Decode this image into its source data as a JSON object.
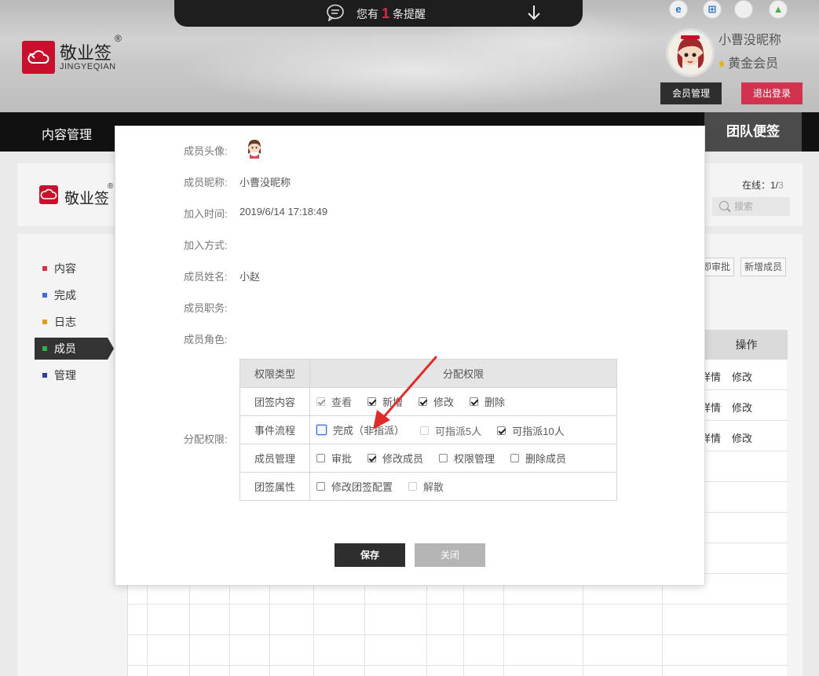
{
  "notice": {
    "prefix": "您有",
    "count": "1",
    "suffix": "条提醒"
  },
  "brand": {
    "name": "敬业签",
    "reg": "®",
    "pinyin": "JINGYEQIAN"
  },
  "os_icons": [
    "ie-icon",
    "windows-icon",
    "apple-icon",
    "android-icon"
  ],
  "user": {
    "name": "小曹没昵称",
    "level": "黄金会员",
    "member_btn": "会员管理",
    "logout_btn": "退出登录"
  },
  "nav": {
    "content_mgmt": "内容管理",
    "team": "团队便签"
  },
  "panel": {
    "online_label": "在线：1/",
    "online_total": "3",
    "search_placeholder": "搜索"
  },
  "sidebar": [
    {
      "label": "内容",
      "color": "#d2324e"
    },
    {
      "label": "完成",
      "color": "#3b6fd6"
    },
    {
      "label": "日志",
      "color": "#e69a1c"
    },
    {
      "label": "成员",
      "color": "#2bb24c"
    },
    {
      "label": "管理",
      "color": "#2c3e9e"
    }
  ],
  "bg_buttons": {
    "approve": "即审批",
    "add_member": "新增成员"
  },
  "bg_table": {
    "ops_header": "操作",
    "rows": [
      {
        "detail": "详情",
        "edit": "修改"
      },
      {
        "detail": "详情",
        "edit": "修改"
      },
      {
        "detail": "详情",
        "edit": "修改"
      }
    ]
  },
  "modal": {
    "fields": {
      "avatar_label": "成员头像:",
      "nickname_label": "成员昵称:",
      "nickname": "小曹没昵称",
      "join_time_label": "加入时间:",
      "join_time": "2019/6/14 17:18:49",
      "join_method_label": "加入方式:",
      "real_name_label": "成员姓名:",
      "real_name": "小赵",
      "position_label": "成员职务:",
      "role_label": "成员角色:",
      "perm_label": "分配权限:"
    },
    "perm_table": {
      "col_type": "权限类型",
      "col_assign": "分配权限",
      "rows": [
        {
          "type": "团签内容",
          "opts": [
            {
              "label": "查看",
              "checked": true,
              "disabled": true
            },
            {
              "label": "新增",
              "checked": true
            },
            {
              "label": "修改",
              "checked": true
            },
            {
              "label": "删除",
              "checked": true
            }
          ]
        },
        {
          "type": "事件流程",
          "opts": [
            {
              "label": "完成（非指派）",
              "checked": false,
              "focus": true
            },
            {
              "label": "可指派5人",
              "checked": false,
              "disabled": true
            },
            {
              "label": "可指派10人",
              "checked": true
            }
          ]
        },
        {
          "type": "成员管理",
          "opts": [
            {
              "label": "审批",
              "checked": false
            },
            {
              "label": "修改成员",
              "checked": true
            },
            {
              "label": "权限管理",
              "checked": false
            },
            {
              "label": "删除成员",
              "checked": false
            }
          ]
        },
        {
          "type": "团签属性",
          "opts": [
            {
              "label": "修改团签配置",
              "checked": false
            },
            {
              "label": "解散",
              "checked": false,
              "disabled": true
            }
          ]
        }
      ]
    },
    "save_btn": "保存",
    "close_btn": "关闭"
  },
  "colors": {
    "brand_red": "#c8102e",
    "logout_red": "#d2324e",
    "arrow_red": "#e02b2b",
    "focus_blue": "#3b6fd6"
  }
}
